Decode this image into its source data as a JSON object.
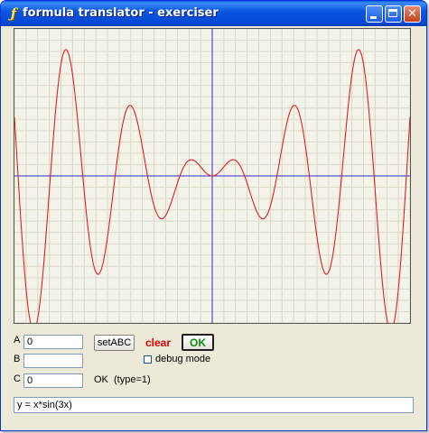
{
  "window": {
    "title": "formula translator - exerciser",
    "app_icon_glyph": "ƒ",
    "close_glyph": "✕"
  },
  "plot": {
    "background": "#f4f3ea",
    "grid_color": "#d9d7c4",
    "axis_color": "#2a2ad0",
    "curve_color": "#e02020",
    "grid_step_ticks": 1
  },
  "controls": {
    "a_label": "A",
    "a_value": "0",
    "b_label": "B",
    "b_value": "",
    "c_label": "C",
    "c_value": "0",
    "setabc_label": "setABC",
    "clear_label": "clear",
    "ok_label": "OK",
    "debug_label": "debug mode",
    "debug_checked": false,
    "status_text": "OK  (type=1)"
  },
  "formula": {
    "value": "y = x*sin(3x)"
  },
  "chart_data": {
    "type": "line",
    "function": "y = x*sin(3x)",
    "xlim": [
      -6.4,
      6.4
    ],
    "ylim": [
      -5.5,
      5.5
    ],
    "grid": true
  }
}
